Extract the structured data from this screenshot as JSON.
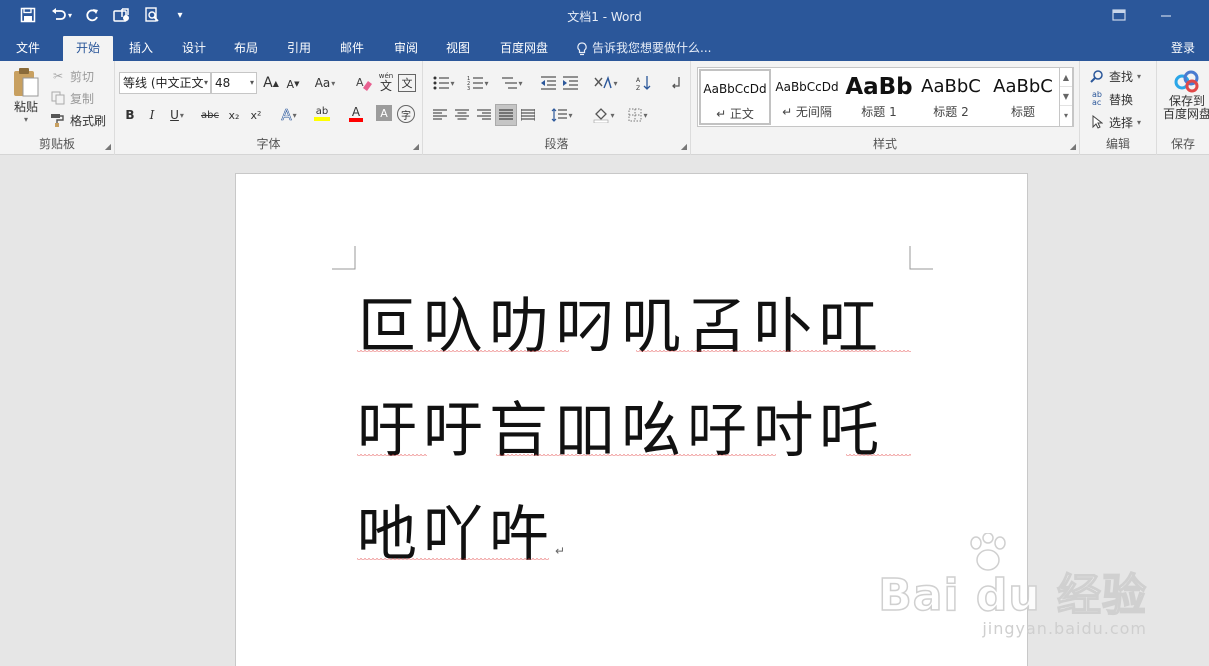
{
  "window": {
    "title": "文档1 - Word",
    "controls": [
      "restore-down-icon",
      "minimize-icon"
    ]
  },
  "quick_access": [
    {
      "name": "save-icon",
      "glyph": "🖫"
    },
    {
      "name": "undo-icon",
      "glyph": "↶"
    },
    {
      "name": "redo-icon",
      "glyph": "↺"
    },
    {
      "name": "touch-mode-icon",
      "glyph": "✋"
    },
    {
      "name": "print-preview-icon",
      "glyph": "🔍"
    },
    {
      "name": "customize-qat-icon",
      "glyph": "▾"
    }
  ],
  "tabs": [
    {
      "label": "文件",
      "active": false
    },
    {
      "label": "开始",
      "active": true
    },
    {
      "label": "插入",
      "active": false
    },
    {
      "label": "设计",
      "active": false
    },
    {
      "label": "布局",
      "active": false
    },
    {
      "label": "引用",
      "active": false
    },
    {
      "label": "邮件",
      "active": false
    },
    {
      "label": "审阅",
      "active": false
    },
    {
      "label": "视图",
      "active": false
    },
    {
      "label": "百度网盘",
      "active": false
    }
  ],
  "tell_me": "告诉我您想要做什么...",
  "login": "登录",
  "ribbon": {
    "clipboard": {
      "label": "剪贴板",
      "paste": "粘贴",
      "cut": "剪切",
      "copy": "复制",
      "format_painter": "格式刷"
    },
    "font": {
      "label": "字体",
      "font_name": "等线 (中文正文",
      "font_size": "48",
      "grow": "A",
      "shrink": "A",
      "case": "Aa",
      "pinyin": "wén",
      "pinyin_char": "文",
      "bold": "B",
      "italic": "I",
      "underline": "U",
      "strike": "abc",
      "subscript": "x₂",
      "superscript": "x²",
      "effects": "A",
      "highlight": "ab",
      "font_color": "A",
      "char_shading": "A",
      "enclose": "字",
      "highlight_color": "#ffff00",
      "font_color_value": "#ff0000"
    },
    "paragraph": {
      "label": "段落"
    },
    "styles": {
      "label": "样式",
      "items": [
        {
          "sample": "AaBbCcDd",
          "name": "↵ 正文",
          "selected": true
        },
        {
          "sample": "AaBbCcDd",
          "name": "↵ 无间隔",
          "selected": false
        },
        {
          "sample": "AaBb",
          "name": "标题 1",
          "selected": false
        },
        {
          "sample": "AaBbC",
          "name": "标题 2",
          "selected": false
        },
        {
          "sample": "AaBbC",
          "name": "标题",
          "selected": false
        }
      ]
    },
    "editing": {
      "label": "编辑",
      "find": "查找",
      "replace": "替换",
      "select": "选择"
    },
    "save": {
      "label": "保存",
      "button_line1": "保存到",
      "button_line2": "百度网盘"
    }
  },
  "document": {
    "lines": [
      "叵叺叻叼叽叾卟叿",
      "吁吁吂吅吆吇吋吒",
      "吔吖吘"
    ],
    "paragraph_mark": "↵"
  },
  "watermark": {
    "main": "Bai du 经验",
    "sub": "jingyan.baidu.com"
  }
}
